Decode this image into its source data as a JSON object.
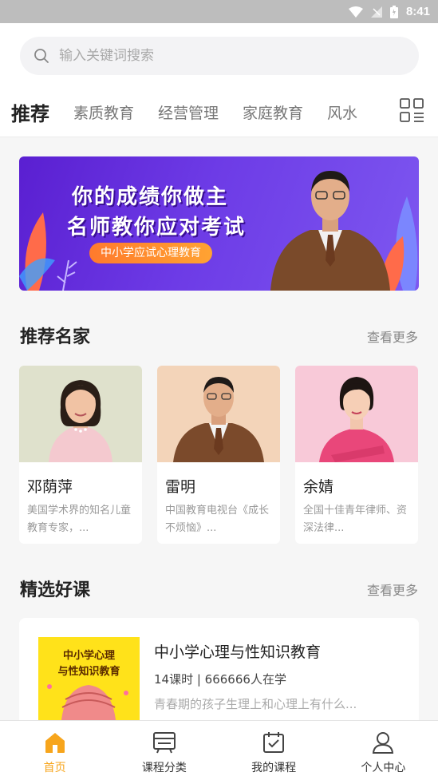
{
  "status_bar": {
    "time": "8:41"
  },
  "search": {
    "placeholder": "输入关键词搜索"
  },
  "tabs": [
    {
      "label": "推荐"
    },
    {
      "label": "素质教育"
    },
    {
      "label": "经营管理"
    },
    {
      "label": "家庭教育"
    },
    {
      "label": "风水"
    }
  ],
  "banner": {
    "line1": "你的成绩你做主",
    "line2": "名师教你应对考试",
    "tag": "中小学应试心理教育"
  },
  "teachers_section": {
    "title": "推荐名家",
    "more": "查看更多"
  },
  "teachers": [
    {
      "name": "邓荫萍",
      "desc": "美国学术界的知名儿童教育专家，..."
    },
    {
      "name": "雷明",
      "desc": "中国教育电视台《成长不烦恼》..."
    },
    {
      "name": "余婧",
      "desc": "全国十佳青年律师、资深法律..."
    }
  ],
  "courses_section": {
    "title": "精选好课",
    "more": "查看更多"
  },
  "course": {
    "cover_line1": "中小学心理",
    "cover_line2": "与性知识教育",
    "title": "中小学心理与性知识教育",
    "meta": "14课时 | 666666人在学",
    "desc": "青春期的孩子生理上和心理上有什么..."
  },
  "bottom_nav": [
    {
      "label": "首页",
      "icon": "home-icon"
    },
    {
      "label": "课程分类",
      "icon": "category-icon"
    },
    {
      "label": "我的课程",
      "icon": "calendar-check-icon"
    },
    {
      "label": "个人中心",
      "icon": "user-icon"
    }
  ],
  "colors": {
    "accent": "#f7a51c",
    "banner_purple": "#5a1fd1",
    "tab_underline": "#ffb300"
  }
}
